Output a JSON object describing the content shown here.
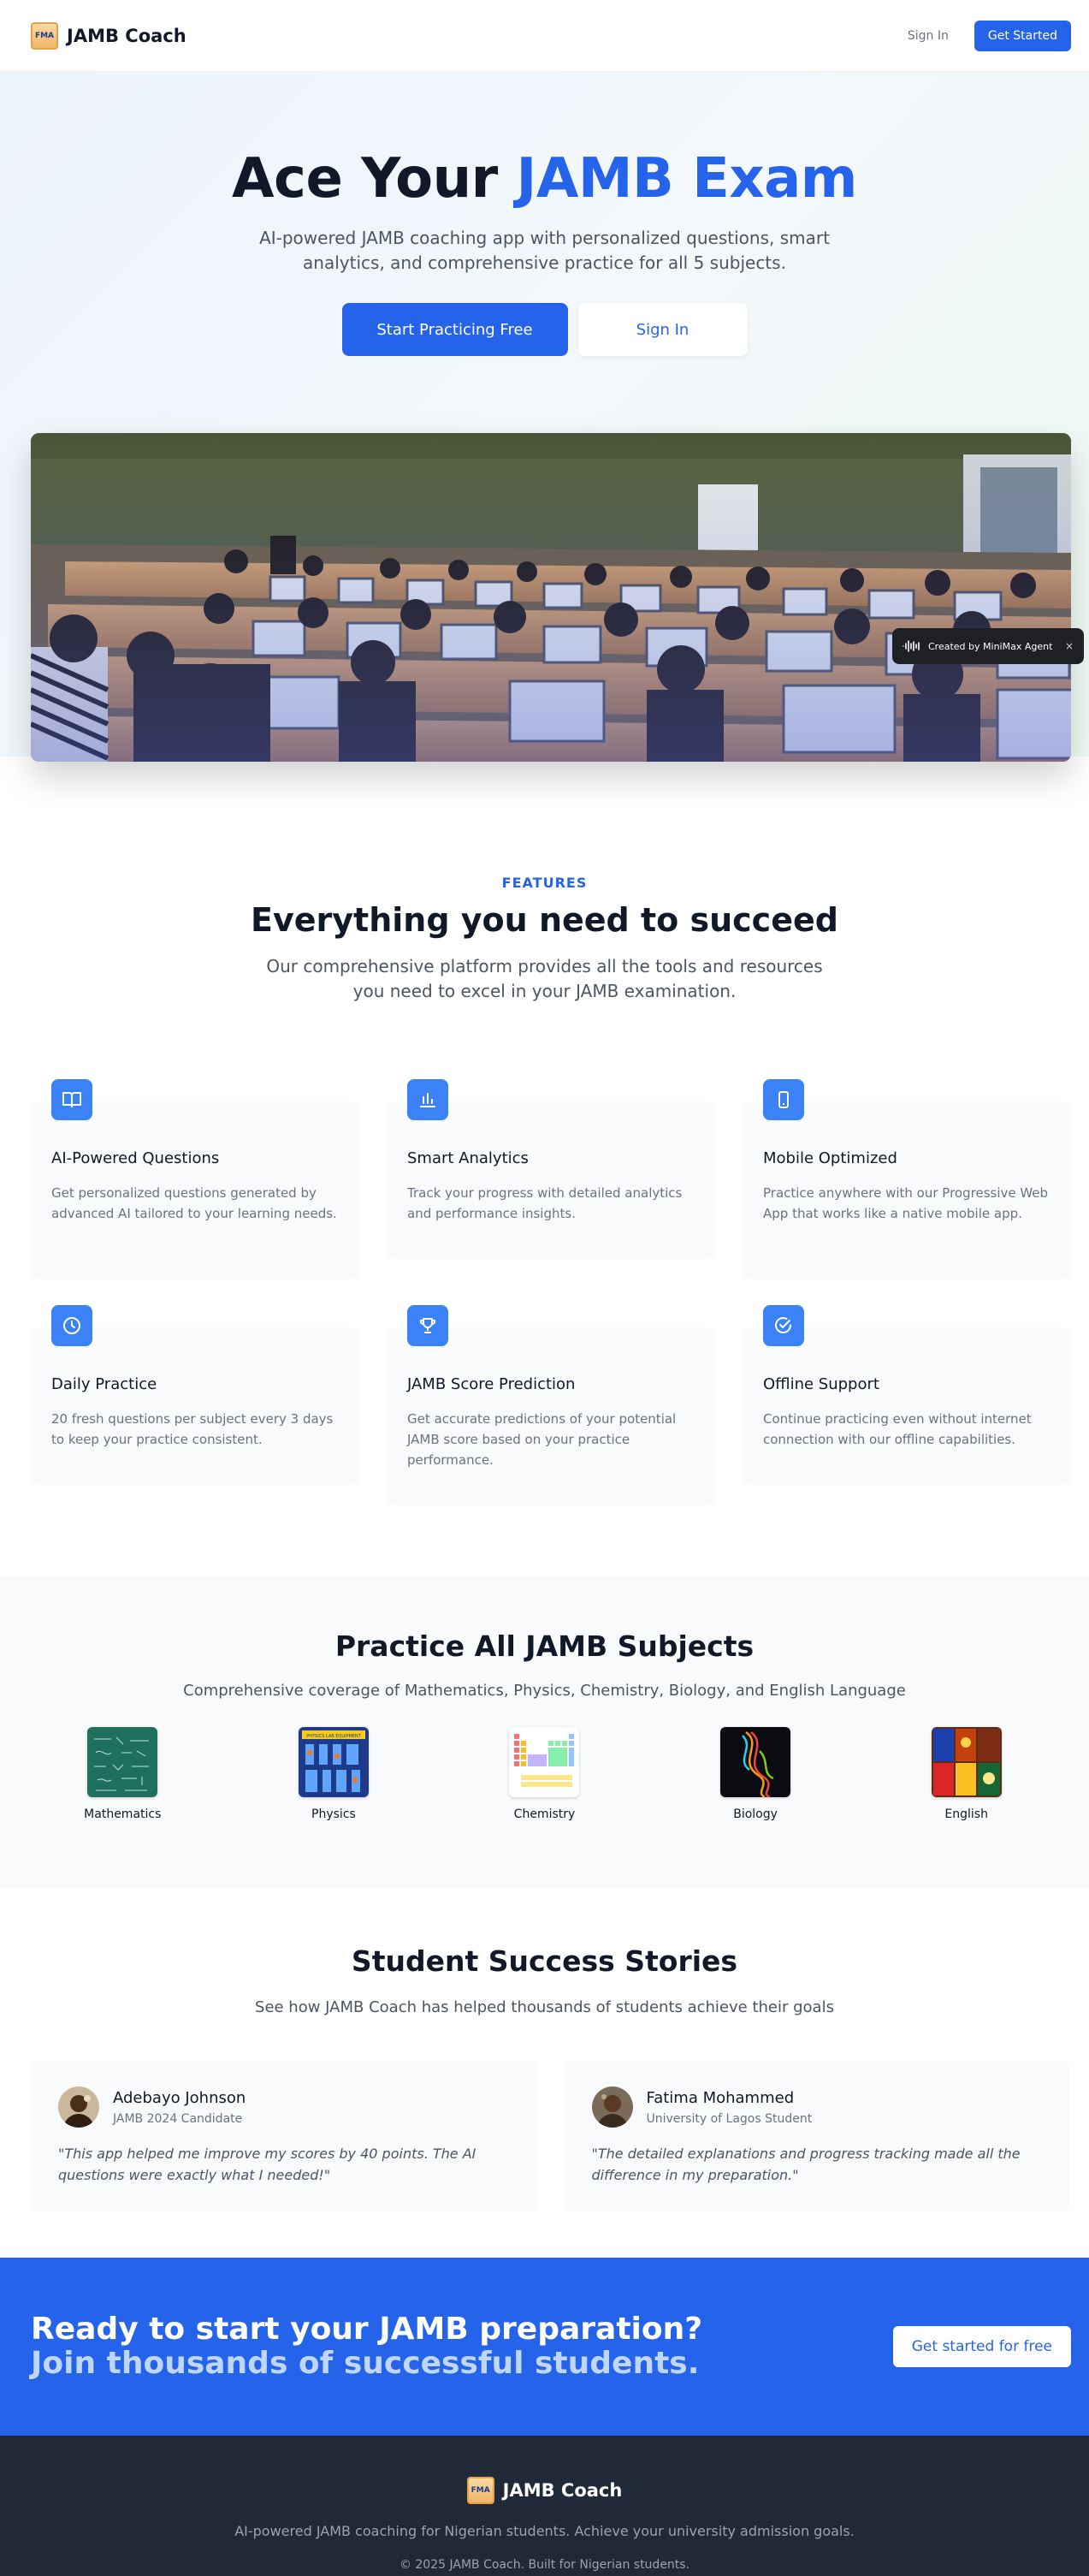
{
  "header": {
    "brand": "JAMB Coach",
    "logo_text": "FMA",
    "signin_label": "Sign In",
    "get_started_label": "Get Started"
  },
  "hero": {
    "title_prefix": "Ace Your ",
    "title_accent": "JAMB Exam",
    "subtitle": "AI-powered JAMB coaching app with personalized questions, smart analytics, and comprehensive practice for all 5 subjects.",
    "primary_cta": "Start Practicing Free",
    "secondary_cta": "Sign In",
    "image_icon": "exam-hall-photo"
  },
  "badge": {
    "label": "Created by MiniMax Agent",
    "close": "×"
  },
  "features": {
    "eyebrow": "FEATURES",
    "title": "Everything you need to succeed",
    "subtitle": "Our comprehensive platform provides all the tools and resources you need to excel in your JAMB examination.",
    "items": [
      {
        "icon": "book-open-icon",
        "title": "AI-Powered Questions",
        "description": "Get personalized questions generated by advanced AI tailored to your learning needs."
      },
      {
        "icon": "bar-chart-icon",
        "title": "Smart Analytics",
        "description": "Track your progress with detailed analytics and performance insights."
      },
      {
        "icon": "smartphone-icon",
        "title": "Mobile Optimized",
        "description": "Practice anywhere with our Progressive Web App that works like a native mobile app."
      },
      {
        "icon": "clock-icon",
        "title": "Daily Practice",
        "description": "20 fresh questions per subject every 3 days to keep your practice consistent."
      },
      {
        "icon": "trophy-icon",
        "title": "JAMB Score Prediction",
        "description": "Get accurate predictions of your potential JAMB score based on your practice performance."
      },
      {
        "icon": "check-circle-icon",
        "title": "Offline Support",
        "description": "Continue practicing even without internet connection with our offline capabilities."
      }
    ],
    "accent_color": "#3b82f6"
  },
  "subjects": {
    "title": "Practice All JAMB Subjects",
    "subtitle": "Comprehensive coverage of Mathematics, Physics, Chemistry, Biology, and English Language",
    "items": [
      {
        "name": "Mathematics"
      },
      {
        "name": "Physics",
        "thumb_text": "PHYSICS LAB EQUIPMENT"
      },
      {
        "name": "Chemistry"
      },
      {
        "name": "Biology"
      },
      {
        "name": "English"
      }
    ]
  },
  "testimonials": {
    "title": "Student Success Stories",
    "subtitle": "See how JAMB Coach has helped thousands of students achieve their goals",
    "items": [
      {
        "name": "Adebayo Johnson",
        "role": "JAMB 2024 Candidate",
        "quote": "\"This app helped me improve my scores by 40 points. The AI questions were exactly what I needed!\""
      },
      {
        "name": "Fatima Mohammed",
        "role": "University of Lagos Student",
        "quote": "\"The detailed explanations and progress tracking made all the difference in my preparation.\""
      }
    ]
  },
  "cta": {
    "line1": "Ready to start your JAMB preparation?",
    "line2": "Join thousands of successful students.",
    "button": "Get started for free"
  },
  "footer": {
    "brand": "JAMB Coach",
    "logo_text": "FMA",
    "tagline": "AI-powered JAMB coaching for Nigerian students. Achieve your university admission goals.",
    "copyright": "© 2025 JAMB Coach. Built for Nigerian students."
  },
  "colors": {
    "primary": "#2563eb",
    "dark": "#111827",
    "muted": "#6b7280",
    "footer_bg": "#1f2937"
  }
}
